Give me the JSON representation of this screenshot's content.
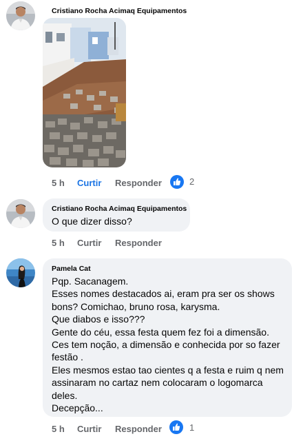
{
  "colors": {
    "bubble": "#f0f2f5",
    "muted_text": "#65676b",
    "liked_blue": "#1b74e4",
    "reaction_blue": "#1877f2"
  },
  "comments": [
    {
      "author": "Cristiano Rocha Acimaq Equipamentos",
      "avatar": "cristiano-avatar",
      "has_photo": true,
      "time": "5 h",
      "like_label": "Curtir",
      "liked": true,
      "reply_label": "Responder",
      "reaction_icon": "like-thumb-icon",
      "reaction_count": "2"
    },
    {
      "author": "Cristiano Rocha Acimaq Equipamentos",
      "avatar": "cristiano-avatar",
      "text_lines": [
        "O que dizer disso?"
      ],
      "time": "5 h",
      "like_label": "Curtir",
      "reply_label": "Responder"
    },
    {
      "author": "Pamela Cat",
      "avatar": "pamela-avatar",
      "text_lines": [
        "Pqp. Sacanagem.",
        "Esses nomes destacados ai, eram pra ser os shows",
        "bons? Comichao, bruno rosa, karysma.",
        "Que diabos e isso???",
        "Gente do céu,  essa festa quem fez foi a dimensão.",
        "Ces tem noção,  a dimensão e conhecida por so fazer",
        "festão .",
        "Eles mesmos estao tao cientes q a festa e ruim  q nem",
        "assinaram no cartaz nem colocaram o logomarca",
        "deles.",
        "Decepção..."
      ],
      "time": "5 h",
      "like_label": "Curtir",
      "reply_label": "Responder",
      "reaction_icon": "like-thumb-icon",
      "reaction_count": "1"
    }
  ]
}
